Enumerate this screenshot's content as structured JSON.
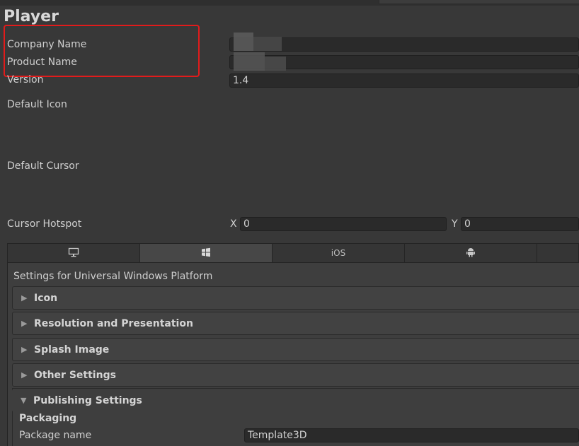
{
  "title": "Player",
  "fields": {
    "company_name_label": "Company Name",
    "product_name_label": "Product Name",
    "version_label": "Version",
    "version_value": "1.4",
    "default_icon_label": "Default Icon",
    "default_cursor_label": "Default Cursor",
    "cursor_hotspot_label": "Cursor Hotspot",
    "hotspot_x_label": "X",
    "hotspot_x_value": "0",
    "hotspot_y_label": "Y",
    "hotspot_y_value": "0"
  },
  "platform_tabs": [
    {
      "name": "standalone",
      "icon": "monitor-icon",
      "label": ""
    },
    {
      "name": "windows",
      "icon": "windows-icon",
      "label": ""
    },
    {
      "name": "ios",
      "icon": "",
      "label": "iOS"
    },
    {
      "name": "android",
      "icon": "android-icon",
      "label": ""
    },
    {
      "name": "more",
      "icon": "",
      "label": ""
    }
  ],
  "selected_tab": "windows",
  "settings_for": "Settings for Universal Windows Platform",
  "foldouts": {
    "icon": "Icon",
    "resolution": "Resolution and Presentation",
    "splash": "Splash Image",
    "other": "Other Settings",
    "publishing": "Publishing Settings"
  },
  "publishing": {
    "packaging_header": "Packaging",
    "package_name_label": "Package name",
    "package_name_value": "Template3D"
  },
  "colors": {
    "background": "#383838",
    "field": "#2a2a2a",
    "highlight": "#e21b1b"
  }
}
